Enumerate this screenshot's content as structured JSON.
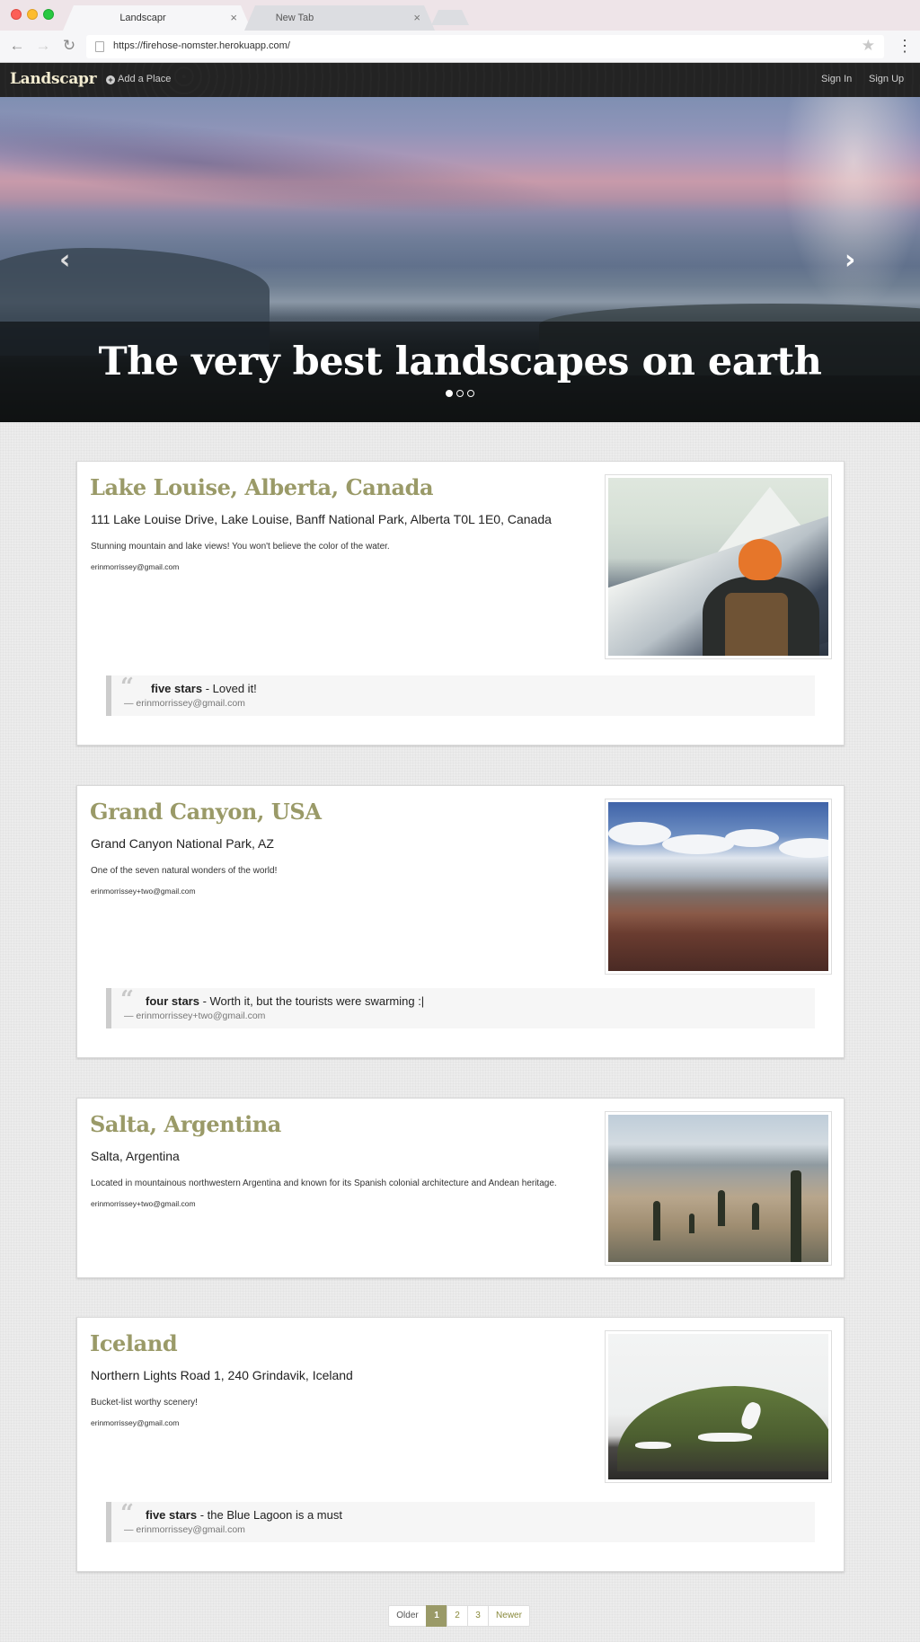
{
  "browser": {
    "tabs": [
      {
        "title": "Landscapr",
        "active": true
      },
      {
        "title": "New Tab",
        "active": false
      }
    ],
    "url": "https://firehose-nomster.herokuapp.com/",
    "icons": {
      "back": "back-arrow-icon",
      "forward": "forward-arrow-icon",
      "reload": "reload-icon",
      "star": "bookmark-star-icon",
      "menu": "kebab-menu-icon",
      "close": "close-icon",
      "page": "page-icon"
    }
  },
  "navbar": {
    "brand": "Landscapr",
    "add_place": "Add a Place",
    "sign_in": "Sign In",
    "sign_up": "Sign Up"
  },
  "hero": {
    "title": "The very best landscapes on earth",
    "slides": 3,
    "active_slide": 1
  },
  "places": [
    {
      "name": "Lake Louise, Alberta, Canada",
      "address": "111 Lake Louise Drive, Lake Louise, Banff National Park, Alberta T0L 1E0, Canada",
      "description": "Stunning mountain and lake views! You won't believe the color of the water.",
      "email": "erinmorrissey@gmail.com",
      "review": {
        "rating": "five stars",
        "text": " - Loved it!",
        "author": "— erinmorrissey@gmail.com"
      }
    },
    {
      "name": "Grand Canyon, USA",
      "address": "Grand Canyon National Park, AZ",
      "description": "One of the seven natural wonders of the world!",
      "email": "erinmorrissey+two@gmail.com",
      "review": {
        "rating": "four stars",
        "text": " - Worth it, but the tourists were swarming :|",
        "author": "— erinmorrissey+two@gmail.com"
      }
    },
    {
      "name": "Salta, Argentina",
      "address": "Salta, Argentina",
      "description": "Located in mountainous northwestern Argentina and known for its Spanish colonial architecture and Andean heritage.",
      "email": "erinmorrissey+two@gmail.com"
    },
    {
      "name": "Iceland",
      "address": "Northern Lights Road 1, 240 Grindavik, Iceland",
      "description": "Bucket-list worthy scenery!",
      "email": "erinmorrissey@gmail.com",
      "review": {
        "rating": "five stars",
        "text": " - the Blue Lagoon is a must",
        "author": "— erinmorrissey@gmail.com"
      }
    }
  ],
  "pagination": {
    "older": "Older",
    "pages": [
      "1",
      "2",
      "3"
    ],
    "current": "1",
    "newer": "Newer"
  },
  "colors": {
    "accent": "#9a9a68",
    "navbar": "#232323",
    "brand": "#f3ecd0"
  }
}
